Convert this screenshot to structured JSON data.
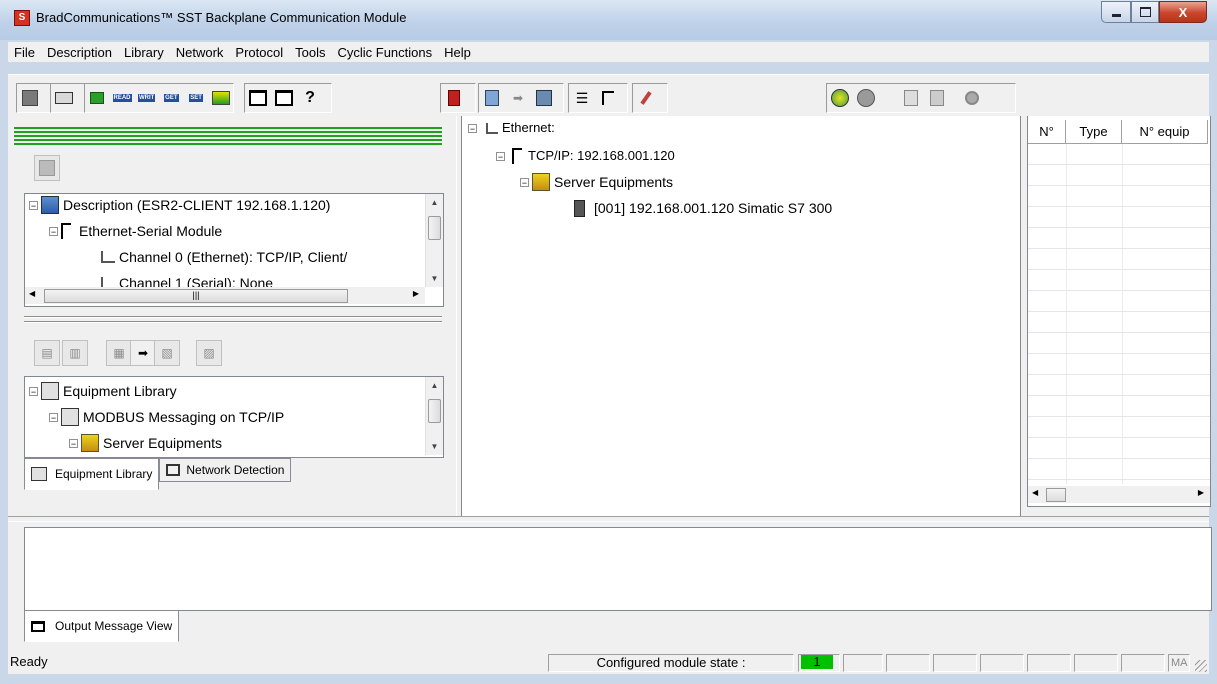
{
  "window": {
    "title": "BradCommunications™ SST Backplane Communication Module",
    "app_icon": "sst-app-icon",
    "caption_buttons": {
      "minimize": "minimize-icon",
      "maximize": "maximize-icon",
      "close": "close-icon"
    }
  },
  "menu": [
    "File",
    "Description",
    "Library",
    "Network",
    "Protocol",
    "Tools",
    "Cyclic Functions",
    "Help"
  ],
  "toolbar": {
    "read_caption": "READ",
    "write_caption": "WRIT",
    "get_caption": "GET",
    "set_caption": "SET",
    "help_glyph": "?"
  },
  "description_tree": {
    "root": "Description (ESR2-CLIENT  192.168.1.120)",
    "module": "Ethernet-Serial Module",
    "channel0": "Channel 0 (Ethernet): TCP/IP, Client/",
    "channel1": "Channel 1 (Serial): None"
  },
  "library_tree": {
    "root": "Equipment Library",
    "modbus": "MODBUS Messaging on TCP/IP",
    "server": "Server Equipments"
  },
  "left_tabs": {
    "equipment_library": "Equipment Library",
    "network_detection": "Network Detection"
  },
  "network_tree": {
    "root": "Ethernet:",
    "tcpip": "TCP/IP: 192.168.001.120",
    "server_equipments": "Server Equipments",
    "equipment": "[001]  192.168.001.120   Simatic S7 300"
  },
  "right_grid": {
    "columns": [
      "N°",
      "Type",
      "N° equip"
    ]
  },
  "output": {
    "tab_label": "Output Message View"
  },
  "status": {
    "text": "Ready",
    "configured_label": "Configured module state :",
    "state_value": "1",
    "state_color": "#00c000",
    "last_cell": "MA"
  }
}
